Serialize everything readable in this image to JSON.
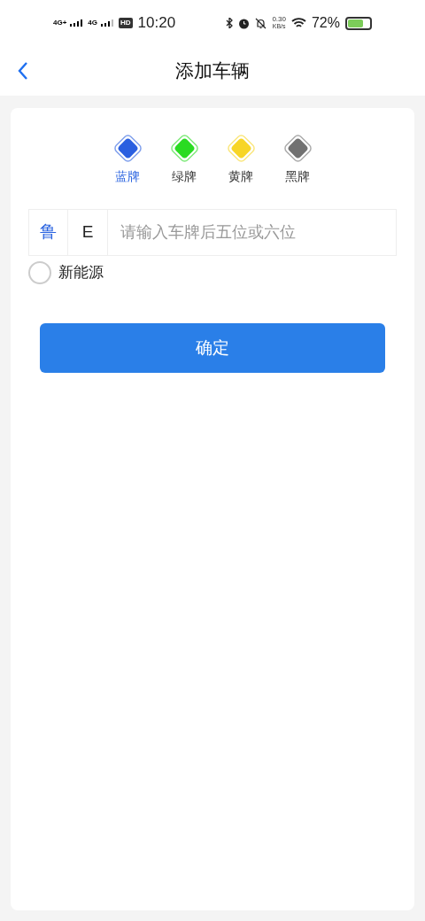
{
  "status_bar": {
    "signal_1": "4G+",
    "signal_2": "4G",
    "hd": "HD",
    "time": "10:20",
    "speed": "0.30",
    "speed_unit": "KB/s",
    "battery": "72%"
  },
  "header": {
    "title": "添加车辆"
  },
  "plate_colors": [
    {
      "label": "蓝牌",
      "color": "#2a5fe0",
      "selected": true
    },
    {
      "label": "绿牌",
      "color": "#2adb22",
      "selected": false
    },
    {
      "label": "黄牌",
      "color": "#f7d526",
      "selected": false
    },
    {
      "label": "黑牌",
      "color": "#717171",
      "selected": false
    }
  ],
  "plate_input": {
    "province": "鲁",
    "letter": "E",
    "placeholder": "请输入车牌后五位或六位"
  },
  "new_energy": {
    "label": "新能源",
    "checked": false
  },
  "confirm_button": "确定"
}
